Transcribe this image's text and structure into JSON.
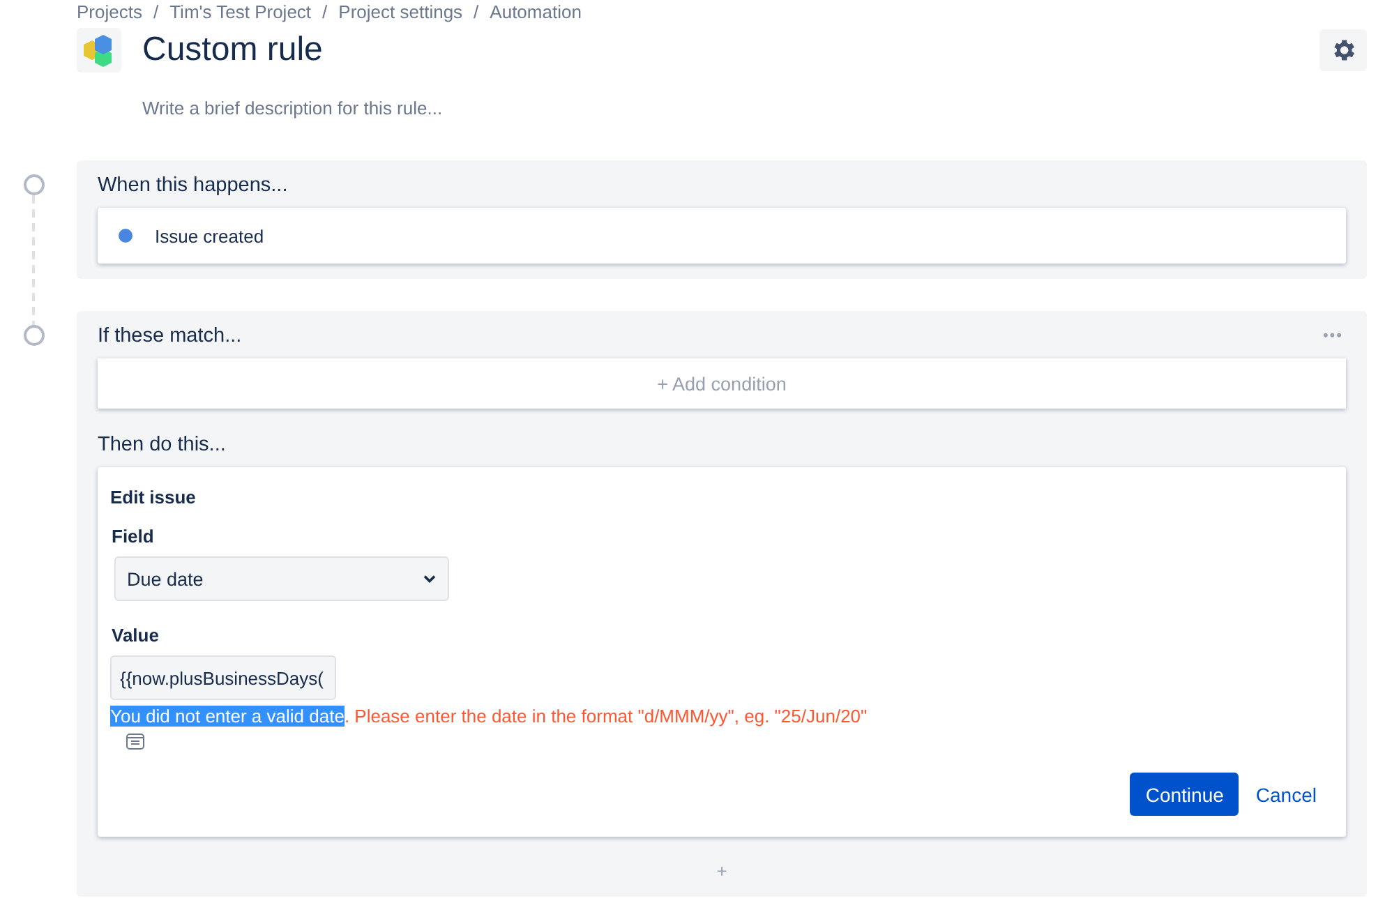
{
  "breadcrumbs": [
    "Projects",
    "Tim's Test Project",
    "Project settings",
    "Automation"
  ],
  "breadcrumb_separator": "/",
  "header": {
    "title": "Custom rule",
    "description_placeholder": "Write a brief description for this rule..."
  },
  "trigger": {
    "heading": "When this happens...",
    "item": {
      "label": "Issue created",
      "color": "#4a86e0"
    }
  },
  "conditions": {
    "heading": "If these match...",
    "more": "•••",
    "add_label": "+ Add condition"
  },
  "actions": {
    "heading": "Then do this...",
    "card": {
      "title": "Edit issue",
      "field_label": "Field",
      "field_value": "Due date",
      "value_label": "Value",
      "value": "{{now.plusBusinessDays(",
      "error_selected": "You did not enter a valid date",
      "error_text": ". Please enter the date in the format \"d/MMM/yy\", eg. \"25/Jun/20\"",
      "continue": "Continue",
      "cancel": "Cancel"
    },
    "add": "+"
  }
}
